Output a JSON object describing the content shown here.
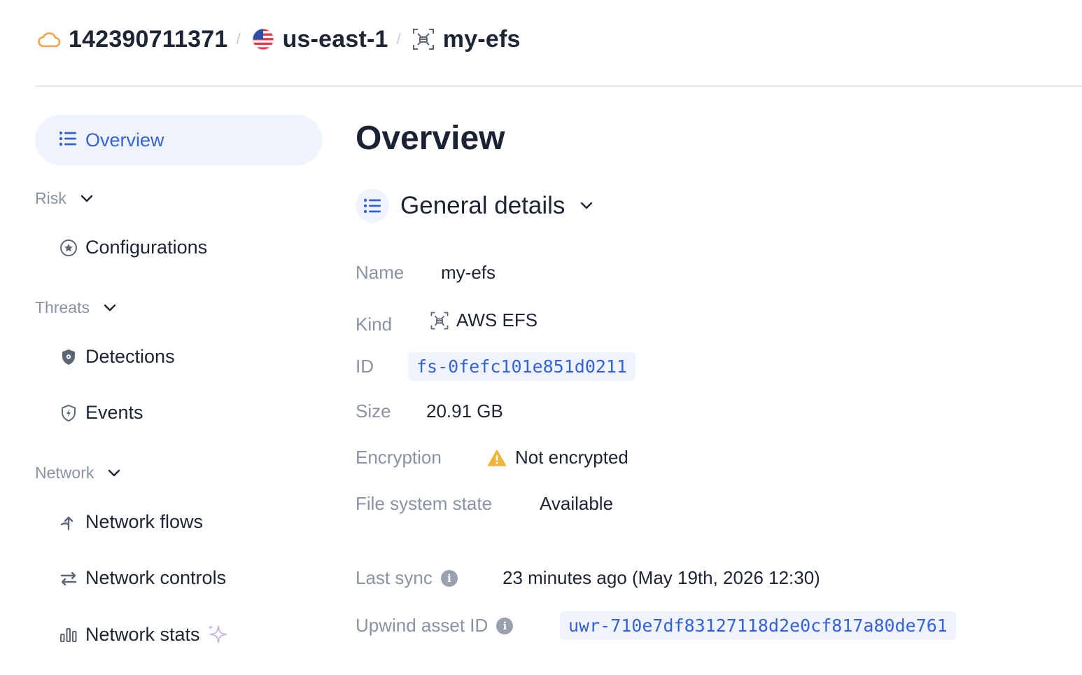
{
  "breadcrumb": {
    "account": "142390711371",
    "region": "us-east-1",
    "resource": "my-efs",
    "separator": "/"
  },
  "sidebar": {
    "active": {
      "label": "Overview",
      "icon": "list-icon"
    },
    "sections": [
      {
        "label": "Risk",
        "items": [
          {
            "label": "Configurations",
            "icon": "star-circle-icon"
          }
        ]
      },
      {
        "label": "Threats",
        "items": [
          {
            "label": "Detections",
            "icon": "shield-gear-icon"
          },
          {
            "label": "Events",
            "icon": "shield-bolt-icon"
          }
        ]
      },
      {
        "label": "Network",
        "items": [
          {
            "label": "Network flows",
            "icon": "flow-arrow-icon"
          },
          {
            "label": "Network controls",
            "icon": "swap-arrows-icon"
          },
          {
            "label": "Network stats",
            "icon": "bar-stats-icon"
          }
        ]
      }
    ]
  },
  "main": {
    "title": "Overview",
    "section_title": "General details",
    "details": {
      "name_label": "Name",
      "name_value": "my-efs",
      "kind_label": "Kind",
      "kind_value": "AWS EFS",
      "id_label": "ID",
      "id_value": "fs-0fefc101e851d0211",
      "size_label": "Size",
      "size_value": "20.91 GB",
      "encryption_label": "Encryption",
      "encryption_value": "Not encrypted",
      "state_label": "File system state",
      "state_value": "Available",
      "sync_label": "Last sync",
      "sync_value": "23 minutes ago (May 19th, 2026 12:30)",
      "asset_label": "Upwind asset ID",
      "asset_value": "uwr-710e7df83127118d2e0cf817a80de761"
    }
  },
  "colors": {
    "accent": "#3562d6",
    "active_bg": "#eef3fc",
    "muted": "#8a93a3",
    "warning": "#f0b43a",
    "cloud": "#f0a44c"
  }
}
